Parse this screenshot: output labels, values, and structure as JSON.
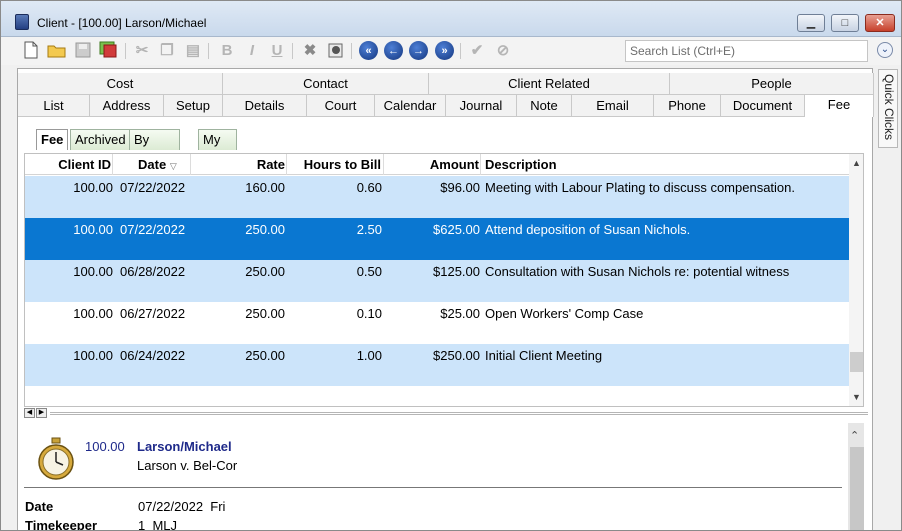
{
  "window": {
    "title": "Client - [100.00] Larson/Michael"
  },
  "window_controls": {
    "minimize": "▁",
    "maximize": "□",
    "close": "✕"
  },
  "search": {
    "placeholder": "Search List (Ctrl+E)"
  },
  "quick_clicks": {
    "label": "Quick Clicks"
  },
  "tab_groups": {
    "row1": [
      "Cost",
      "Contact",
      "Client Related",
      "People"
    ],
    "row2": [
      "List",
      "Address",
      "Setup",
      "Details",
      "Court",
      "Calendar",
      "Journal",
      "Note",
      "Email",
      "Phone",
      "Document",
      "Fee"
    ]
  },
  "active_tab": "Fee",
  "subtabs": [
    "Fee",
    "Archived",
    "By Activity",
    "My Fees"
  ],
  "grid": {
    "columns": {
      "client_id": "Client ID",
      "date": "Date",
      "sort_indicator": "▽",
      "rate": "Rate",
      "hours": "Hours to Bill",
      "amount": "Amount",
      "description": "Description"
    },
    "rows": [
      {
        "client_id": "100.00",
        "date": "07/22/2022",
        "rate": "160.00",
        "hours": "0.60",
        "amount": "$96.00",
        "description": "Meeting with Labour Plating to discuss compensation.",
        "state": "alt"
      },
      {
        "client_id": "100.00",
        "date": "07/22/2022",
        "rate": "250.00",
        "hours": "2.50",
        "amount": "$625.00",
        "description": "Attend deposition of Susan Nichols.",
        "state": "selected"
      },
      {
        "client_id": "100.00",
        "date": "06/28/2022",
        "rate": "250.00",
        "hours": "0.50",
        "amount": "$125.00",
        "description": "Consultation with Susan Nichols re: potential witness",
        "state": "alt"
      },
      {
        "client_id": "100.00",
        "date": "06/27/2022",
        "rate": "250.00",
        "hours": "0.10",
        "amount": "$25.00",
        "description": "Open Workers' Comp Case",
        "state": "plain"
      },
      {
        "client_id": "100.00",
        "date": "06/24/2022",
        "rate": "250.00",
        "hours": "1.00",
        "amount": "$250.00",
        "description": "Initial Client Meeting",
        "state": "alt"
      }
    ]
  },
  "detail": {
    "client_number": "100.00",
    "client_name": "Larson/Michael",
    "case_name": "Larson v. Bel-Cor",
    "date_label": "Date",
    "date_value": "07/22/2022  Fri",
    "timekeeper_label": "Timekeeper",
    "timekeeper_value": "1  MLJ"
  },
  "colors": {
    "row_alt": "#cce4fa",
    "row_selected": "#0a77d1",
    "detail_text": "#1f2a8a"
  }
}
